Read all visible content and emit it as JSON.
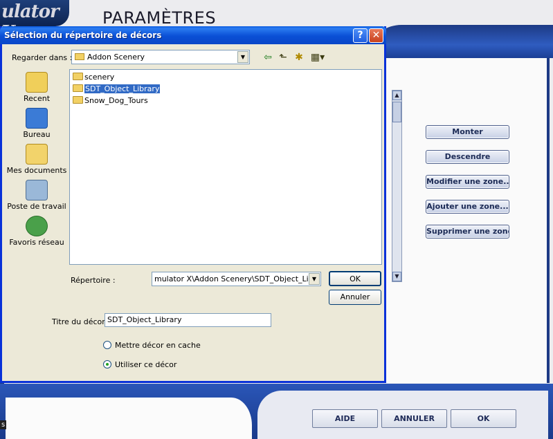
{
  "app": {
    "logo_text": "ulator X",
    "title": "PARAMÈTRES",
    "footer_left_label": "s",
    "side_buttons": [
      "Monter",
      "Descendre",
      "Modifier une zone...",
      "Ajouter une zone...",
      "Supprimer une zone"
    ],
    "footer_buttons": {
      "help": "AIDE",
      "cancel": "ANNULER",
      "ok": "OK"
    }
  },
  "dialog": {
    "title": "Sélection du répertoire de décors",
    "look_in_label": "Regarder dans :",
    "look_in_value": "Addon Scenery",
    "toolbar_icons": [
      "back-icon",
      "up-folder-icon",
      "new-folder-icon",
      "view-menu-icon"
    ],
    "places": [
      {
        "label": "Recent",
        "icon": "recent-icon"
      },
      {
        "label": "Bureau",
        "icon": "desktop-icon"
      },
      {
        "label": "Mes documents",
        "icon": "my-documents-icon"
      },
      {
        "label": "Poste de travail",
        "icon": "my-computer-icon"
      },
      {
        "label": "Favoris réseau",
        "icon": "network-places-icon"
      }
    ],
    "files": [
      {
        "name": "scenery",
        "selected": false
      },
      {
        "name": "SDT_Object_Library",
        "selected": true
      },
      {
        "name": "Snow_Dog_Tours",
        "selected": false
      }
    ],
    "directory_label": "Répertoire :",
    "directory_value": "mulator X\\Addon Scenery\\SDT_Object_Library",
    "ok_label": "OK",
    "cancel_label": "Annuler",
    "scenery_title_label": "Titre du décor :",
    "scenery_title_value": "SDT_Object_Library",
    "radio_cache_label": "Mettre décor en cache",
    "radio_use_label": "Utiliser ce décor",
    "radio_use_selected": true
  },
  "colors": {
    "titlebar": "#0a4fd6",
    "selection": "#316ac5",
    "dialog_bg": "#ece9d8",
    "app_blue": "#1d3a85"
  }
}
